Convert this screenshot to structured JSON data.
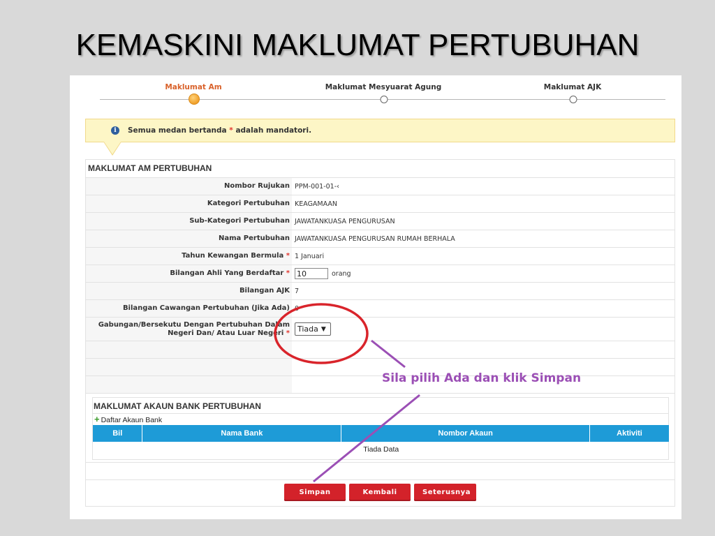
{
  "slide": {
    "title": "KEMASKINI MAKLUMAT PERTUBUHAN"
  },
  "wizard": {
    "steps": [
      {
        "label": "Maklumat Am",
        "active": true
      },
      {
        "label": "Maklumat Mesyuarat Agung",
        "active": false
      },
      {
        "label": "Maklumat AJK",
        "active": false
      }
    ]
  },
  "notice": {
    "before": "Semua medan bertanda",
    "star": "*",
    "after": "adalah mandatori."
  },
  "section": {
    "title": "MAKLUMAT AM PERTUBUHAN"
  },
  "fields": {
    "nombor_rujukan": {
      "label": "Nombor Rujukan",
      "value": "PPM-001-01-‹"
    },
    "kategori": {
      "label": "Kategori Pertubuhan",
      "value": "KEAGAMAAN"
    },
    "sub_kategori": {
      "label": "Sub-Kategori Pertubuhan",
      "value": "JAWATANKUASA PENGURUSAN"
    },
    "nama": {
      "label": "Nama Pertubuhan",
      "value": "JAWATANKUASA PENGURUSAN RUMAH BERHALA"
    },
    "tahun_kewangan": {
      "label": "Tahun Kewangan Bermula",
      "value": "1 Januari"
    },
    "bilangan_ahli": {
      "label": "Bilangan Ahli Yang Berdaftar",
      "value": "10",
      "unit": "orang"
    },
    "bilangan_ajk": {
      "label": "Bilangan AJK",
      "value": "7"
    },
    "bilangan_cawangan": {
      "label": "Bilangan Cawangan Pertubuhan (Jika Ada)",
      "value": "0"
    },
    "gabungan": {
      "label": "Gabungan/Bersekutu Dengan Pertubuhan Dalam Negeri Dan/ Atau Luar Negeri",
      "value": "Tiada"
    }
  },
  "required_star": "*",
  "bank": {
    "title": "MAKLUMAT AKAUN BANK PERTUBUHAN",
    "add_label": "Daftar Akaun Bank",
    "columns": [
      "Bil",
      "Nama Bank",
      "Nombor Akaun",
      "Aktiviti"
    ],
    "empty_text": "Tiada Data"
  },
  "buttons": {
    "simpan": "Simpan",
    "kembali": "Kembali",
    "seterusnya": "Seterusnya"
  },
  "annotation": {
    "text": "Sila pilih Ada dan klik Simpan",
    "color": "#9b4fb5",
    "circle_color": "#d9242b"
  },
  "colors": {
    "accent": "#d9622b",
    "header_blue": "#1e9bd7",
    "button_red": "#d3222a"
  }
}
